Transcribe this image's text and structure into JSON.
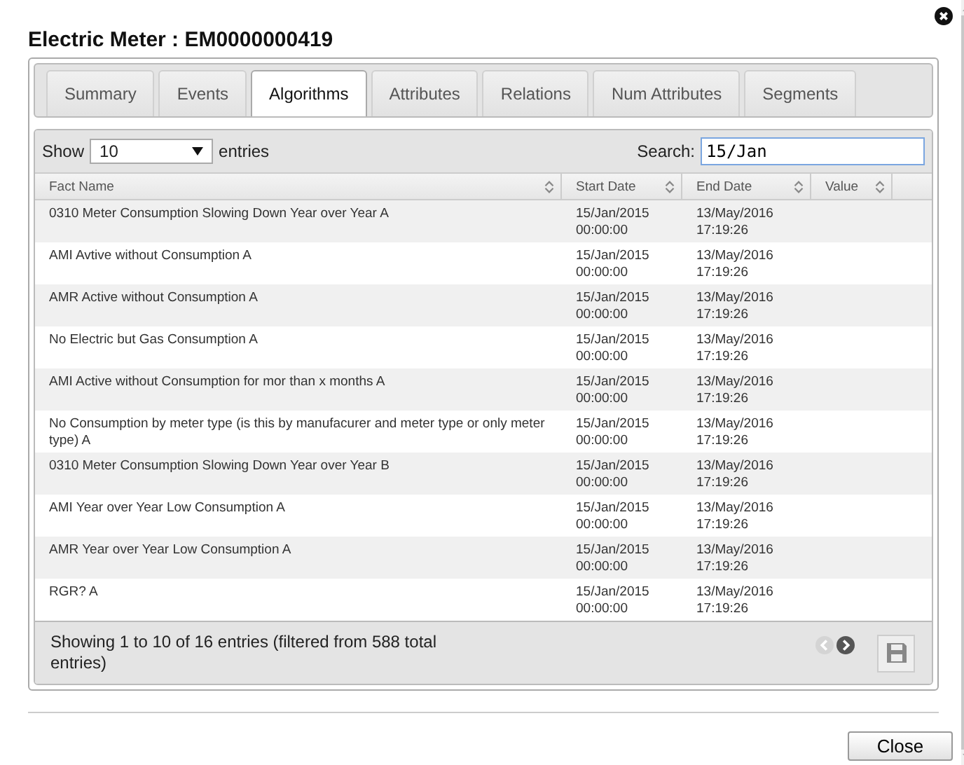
{
  "dialog": {
    "title": "Electric Meter : EM0000000419"
  },
  "tabs": [
    {
      "label": "Summary",
      "selected": false
    },
    {
      "label": "Events",
      "selected": false
    },
    {
      "label": "Algorithms",
      "selected": true
    },
    {
      "label": "Attributes",
      "selected": false
    },
    {
      "label": "Relations",
      "selected": false
    },
    {
      "label": "Num Attributes",
      "selected": false
    },
    {
      "label": "Segments",
      "selected": false
    }
  ],
  "length_control": {
    "prefix": "Show",
    "value": "10",
    "suffix": "entries"
  },
  "search": {
    "label": "Search:",
    "value": "15/Jan"
  },
  "table": {
    "columns": [
      "Fact Name",
      "Start Date",
      "End Date",
      "Value"
    ],
    "rows": [
      {
        "fact_name": "0310 Meter Consumption Slowing Down Year over Year A",
        "start_date": "15/Jan/2015 00:00:00",
        "end_date": "13/May/2016 17:19:26"
      },
      {
        "fact_name": "AMI Avtive without Consumption A",
        "start_date": "15/Jan/2015 00:00:00",
        "end_date": "13/May/2016 17:19:26"
      },
      {
        "fact_name": "AMR Active without Consumption A",
        "start_date": "15/Jan/2015 00:00:00",
        "end_date": "13/May/2016 17:19:26"
      },
      {
        "fact_name": "No Electric but Gas Consumption A",
        "start_date": "15/Jan/2015 00:00:00",
        "end_date": "13/May/2016 17:19:26"
      },
      {
        "fact_name": "AMI Active without Consumption for mor than x months A",
        "start_date": "15/Jan/2015 00:00:00",
        "end_date": "13/May/2016 17:19:26"
      },
      {
        "fact_name": "No Consumption by meter type (is this by manufacurer and meter type or only meter type) A",
        "start_date": "15/Jan/2015 00:00:00",
        "end_date": "13/May/2016 17:19:26"
      },
      {
        "fact_name": "0310 Meter Consumption Slowing Down Year over Year B",
        "start_date": "15/Jan/2015 00:00:00",
        "end_date": "13/May/2016 17:19:26"
      },
      {
        "fact_name": "AMI Year over Year Low Consumption A",
        "start_date": "15/Jan/2015 00:00:00",
        "end_date": "13/May/2016 17:19:26"
      },
      {
        "fact_name": "AMR Year over Year Low Consumption A",
        "start_date": "15/Jan/2015 00:00:00",
        "end_date": "13/May/2016 17:19:26"
      },
      {
        "fact_name": "RGR? A",
        "start_date": "15/Jan/2015 00:00:00",
        "end_date": "13/May/2016 17:19:26"
      }
    ]
  },
  "info": "Showing 1 to 10 of 16 entries (filtered from 588 total entries)",
  "pagination": {
    "previous_disabled": true,
    "next_disabled": false
  },
  "close_button": "Close"
}
